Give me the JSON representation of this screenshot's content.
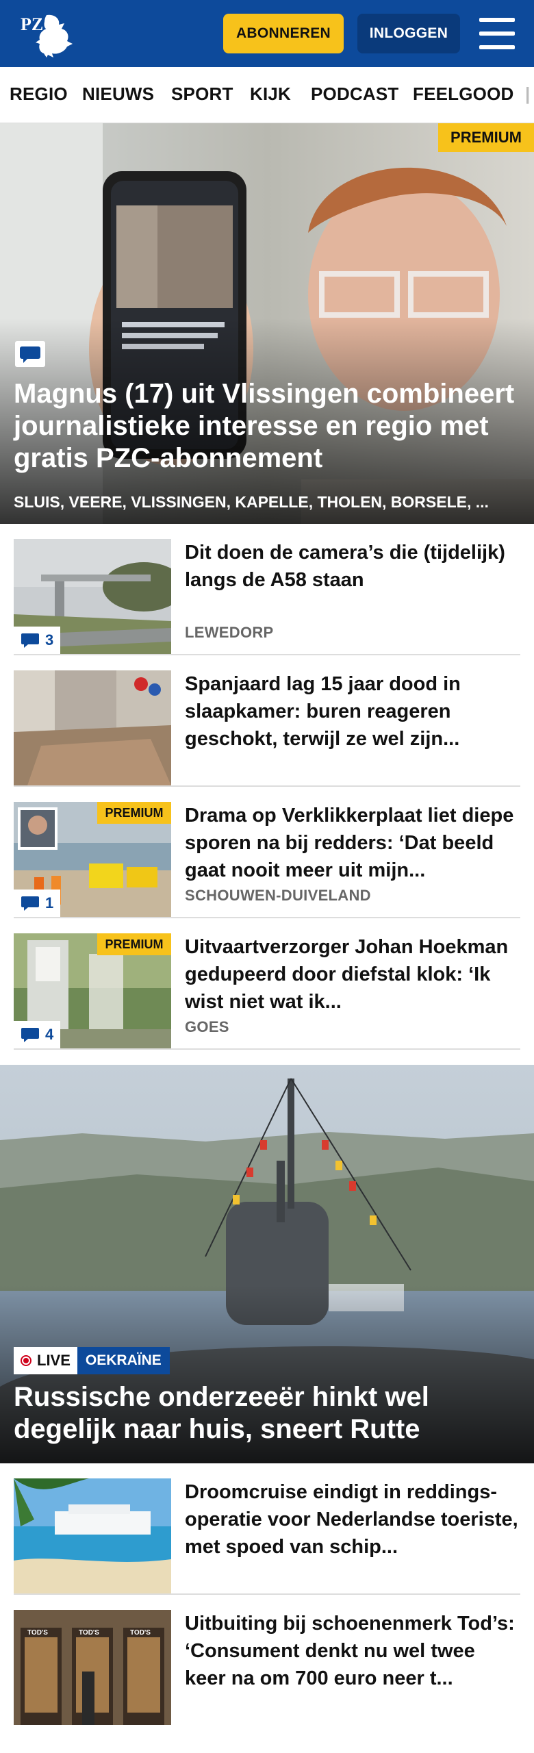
{
  "brand": {
    "logo_text": "PZC"
  },
  "header": {
    "subscribe_label": "ABONNEREN",
    "login_label": "INLOGGEN",
    "menu_icon": "hamburger-menu-icon"
  },
  "nav": {
    "items": [
      "REGIO",
      "NIEUWS",
      "SPORT",
      "KIJK",
      "PODCAST",
      "FEELGOOD"
    ]
  },
  "hero": {
    "premium_label": "PREMIUM",
    "comment_icon": "comment-icon",
    "title": "Magnus (17) uit Vlissingen combineert journalistieke interesse en regio met gratis PZC-abonnement",
    "tags": "SLUIS, VEERE, VLISSINGEN, KAPELLE, THOLEN, BORSELE, ..."
  },
  "articles": [
    {
      "title": "Dit doen de camera’s die (tijdelijk) langs de A58 staan",
      "location": "LEWEDORP",
      "comments": "3",
      "premium": ""
    },
    {
      "title": "Spanjaard lag 15 jaar dood in slaapkamer: buren reageren geschokt, terwijl ze wel zijn...",
      "location": "",
      "comments": "",
      "premium": ""
    },
    {
      "title": "Drama op Verklikkerplaat liet diepe sporen na bij redders: ‘Dat beeld gaat nooit meer uit mijn...",
      "location": "SCHOUWEN-DUIVELAND",
      "comments": "1",
      "premium": "PREMIUM"
    },
    {
      "title": "Uitvaartverzorger Johan Hoekman gedupeerd door diefstal klok: ‘Ik wist niet wat ik...",
      "location": "GOES",
      "comments": "4",
      "premium": "PREMIUM"
    }
  ],
  "feature": {
    "live_label": "LIVE",
    "topic_label": "OEKRAÏNE",
    "title": "Russische onderzeeër hinkt wel degelijk naar huis, sneert Rutte"
  },
  "articles2": [
    {
      "title": "Droomcruise eindigt in reddings-operatie voor Nederlandse toeriste, met spoed van schip..."
    },
    {
      "title": "Uitbuiting bij schoenenmerk Tod’s: ‘Consument denkt nu wel twee keer na om 700 euro neer t..."
    }
  ],
  "colors": {
    "brand_blue": "#0d4a9b",
    "accent_yellow": "#f7c21b",
    "live_red": "#d0021b"
  }
}
